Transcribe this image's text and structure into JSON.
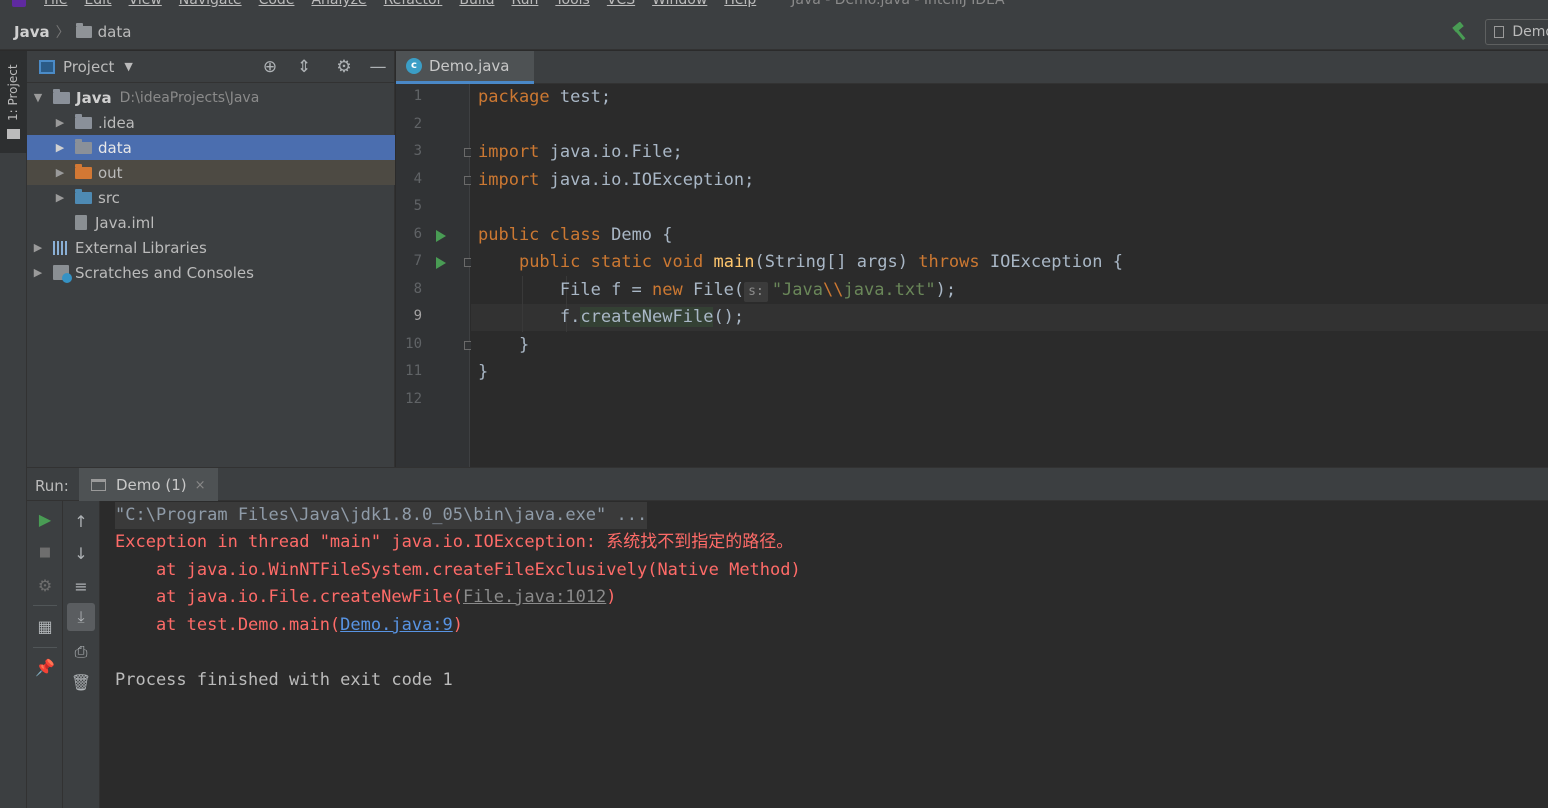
{
  "menubar": {
    "items": [
      "File",
      "Edit",
      "View",
      "Navigate",
      "Code",
      "Analyze",
      "Refactor",
      "Build",
      "Run",
      "Tools",
      "VCS",
      "Window",
      "Help"
    ],
    "window_title": "Java - Demo.java - IntelliJ IDEA"
  },
  "navbar": {
    "project": "Java",
    "folder": "data",
    "run_config": "Demo"
  },
  "left_strip": {
    "project_tab": "1: Project"
  },
  "project_panel": {
    "title": "Project",
    "tree": [
      {
        "label": "Java",
        "path": "D:\\ideaProjects\\Java"
      },
      {
        "label": ".idea"
      },
      {
        "label": "data"
      },
      {
        "label": "out"
      },
      {
        "label": "src"
      },
      {
        "label": "Java.iml"
      },
      {
        "label": "External Libraries"
      },
      {
        "label": "Scratches and Consoles"
      }
    ]
  },
  "editor": {
    "tab_label": "Demo.java",
    "line_numbers": [
      "1",
      "2",
      "3",
      "4",
      "5",
      "6",
      "7",
      "8",
      "9",
      "10",
      "11",
      "12"
    ],
    "current_line": "9",
    "code": {
      "l1_kw": "package",
      "l1_rest": " test;",
      "l3_kw": "import",
      "l3_rest": " java.io.File;",
      "l4_kw": "import",
      "l4_rest": " java.io.IOException;",
      "l6_kw1": "public",
      "l6_kw2": "class",
      "l6_rest": " Demo {",
      "l7_kw1": "public",
      "l7_kw2": "static",
      "l7_kw3": "void",
      "l7_fn": "main",
      "l7_mid": "(String[] args) ",
      "l7_kw4": "throws",
      "l7_rest": " IOException {",
      "l8_a": "File f = ",
      "l8_kw": "new",
      "l8_b": " File(",
      "l8_hint": "s:",
      "l8_str1": "\"Java",
      "l8_esc": "\\\\",
      "l8_str2": "java.txt\"",
      "l8_c": ");",
      "l9_a": "f.",
      "l9_call": "createNewFile",
      "l9_b": "();",
      "l10": "}",
      "l11": "}"
    }
  },
  "run_panel": {
    "label": "Run:",
    "tab_label": "Demo (1)",
    "tab_close": "×",
    "console": {
      "cmd": "\"C:\\Program Files\\Java\\jdk1.8.0_05\\bin\\java.exe\" ...",
      "exception": "Exception in thread \"main\" java.io.IOException: 系统找不到指定的路径。",
      "trace1": "    at java.io.WinNTFileSystem.createFileExclusively(Native Method)",
      "trace2_pre": "    at java.io.File.createNewFile(",
      "trace2_link": "File.java:1012",
      "trace2_post": ")",
      "trace3_pre": "    at test.Demo.main(",
      "trace3_link": "Demo.java:9",
      "trace3_post": ")",
      "finished": "Process finished with exit code 1"
    }
  },
  "colors": {
    "keyword": "#cc7832",
    "function": "#ffc66d",
    "string": "#6a8759",
    "error": "#ff6b68",
    "link": "#5894e4",
    "selection": "#4b6eaf"
  }
}
